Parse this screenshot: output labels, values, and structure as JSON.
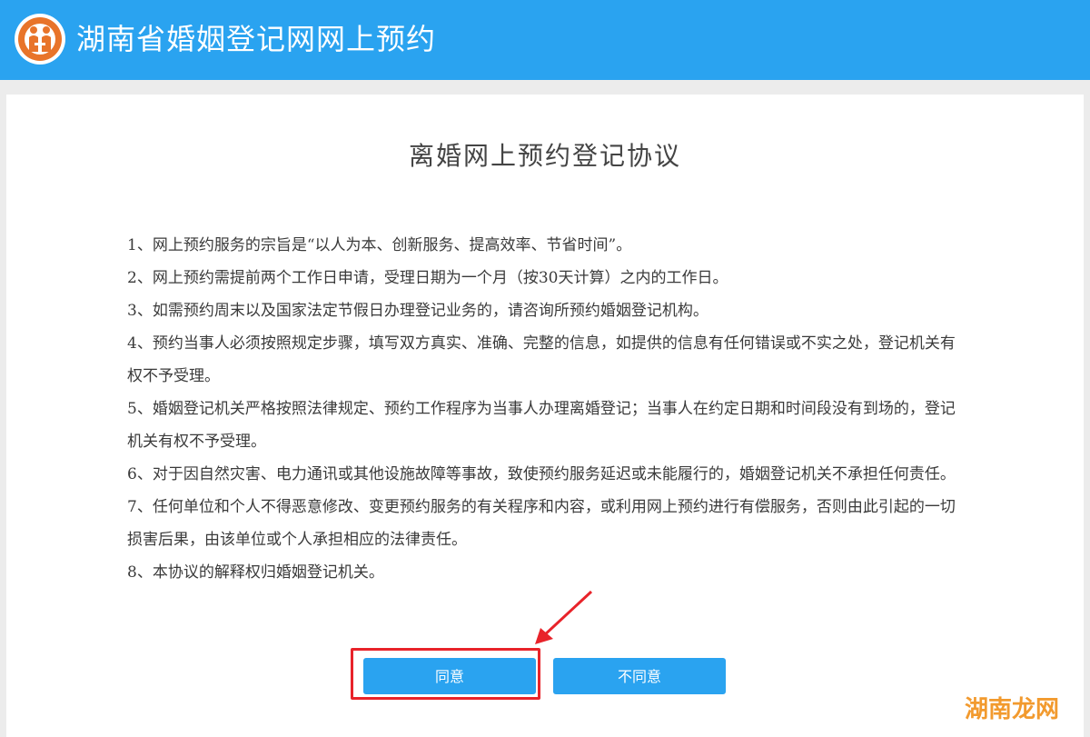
{
  "header": {
    "title": "湖南省婚姻登记网网上预约",
    "logo_icon": "marriage-registration-emblem-icon",
    "background_color": "#2aa3f0"
  },
  "agreement": {
    "title": "离婚网上预约登记协议",
    "terms": [
      "1、网上预约服务的宗旨是“以人为本、创新服务、提高效率、节省时间”。",
      "2、网上预约需提前两个工作日申请，受理日期为一个月（按30天计算）之内的工作日。",
      "3、如需预约周末以及国家法定节假日办理登记业务的，请咨询所预约婚姻登记机构。",
      "4、预约当事人必须按照规定步骤，填写双方真实、准确、完整的信息，如提供的信息有任何错误或不实之处，登记机关有权不予受理。",
      "5、婚姻登记机关严格按照法律规定、预约工作程序为当事人办理离婚登记；当事人在约定日期和时间段没有到场的，登记机关有权不予受理。",
      "6、对于因自然灾害、电力通讯或其他设施故障等事故，致使预约服务延迟或未能履行的，婚姻登记机关不承担任何责任。",
      "7、任何单位和个人不得恶意修改、变更预约服务的有关程序和内容，或利用网上预约进行有偿服务，否则由此引起的一切损害后果，由该单位或个人承担相应的法律责任。",
      "8、本协议的解释权归婚姻登记机关。"
    ]
  },
  "buttons": {
    "agree_label": "同意",
    "disagree_label": "不同意",
    "button_color": "#2aa3f0"
  },
  "annotation": {
    "highlight_color": "#e8232a",
    "arrow_icon": "red-pointer-arrow-icon"
  },
  "watermark": {
    "text": "湖南龙网"
  }
}
